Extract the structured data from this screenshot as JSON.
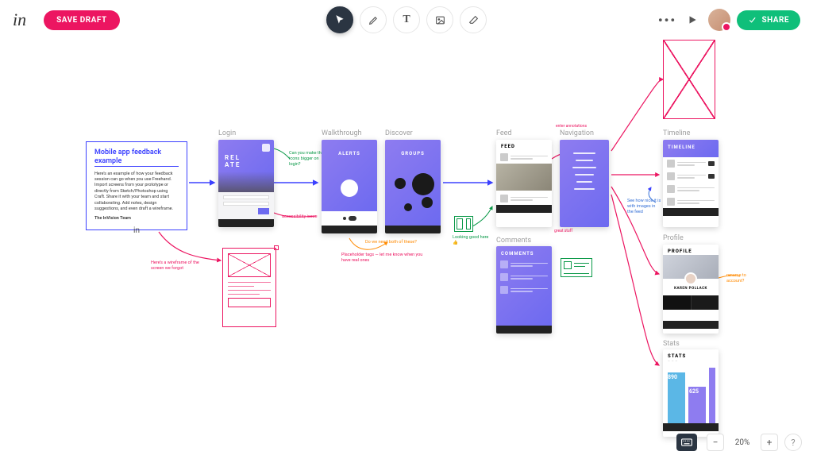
{
  "topbar": {
    "logo": "in",
    "save_draft": "SAVE DRAFT",
    "share": "SHARE"
  },
  "zoom": {
    "level": "20%",
    "minus": "−",
    "plus": "+",
    "help": "?"
  },
  "intro": {
    "title": "Mobile app feedback example",
    "body": "Here’s an example of how your feedback session can go when you use Freehand. Import screens from your prototype or directly from Sketch/Photoshop using Craft. Share it with your team and start collaborating. Add notes, design suggestions, and even draft a wireframe.",
    "team": "The InVision Team"
  },
  "screens": {
    "login": {
      "label": "Login",
      "title": "REL\nATE"
    },
    "walkthrough": {
      "label": "Walkthrough",
      "title": "ALERTS"
    },
    "discover": {
      "label": "Discover",
      "title": "GROUPS"
    },
    "feed": {
      "label": "Feed",
      "title": "FEED"
    },
    "navigation": {
      "label": "Navigation"
    },
    "comments": {
      "label": "Comments",
      "title": "COMMENTS"
    },
    "timeline": {
      "label": "Timeline",
      "title": "TIMELINE"
    },
    "profile": {
      "label": "Profile",
      "title": "PROFILE",
      "name": "KAREN POLLACK"
    },
    "stats": {
      "label": "Stats",
      "title": "STATS",
      "a": "890",
      "b": "625"
    }
  },
  "notes": {
    "login_green": "Can you make the icons bigger on login?",
    "login_pink": "accessibility issue",
    "sketch_pink": "Here’s a wireframe of the screen we forgot",
    "discover_orange": "Do we need both of these?",
    "discover_pink": "Placeholder tags — let me know when you have real ones",
    "feed_green": "Looking good here 👍",
    "feed_pink": "great stuff",
    "nav_pink": "enter annotations",
    "timeline_blue": "See how nice it is with images in the feed",
    "profile_orange": "rename to account?"
  }
}
